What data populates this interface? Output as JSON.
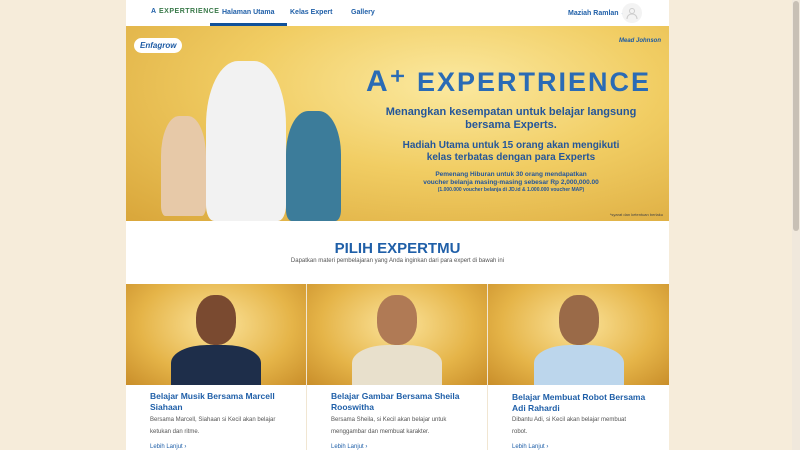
{
  "nav": {
    "logo": "EXPERTRIENCE",
    "items": [
      "Halaman Utama",
      "Kelas Expert",
      "Gallery"
    ],
    "user": "Maziah Ramlan"
  },
  "banner": {
    "brand": "Enfagrow",
    "maker": "Mead Johnson",
    "title": "EXPERTRIENCE",
    "line1": "Menangkan kesempatan untuk belajar langsung",
    "line2": "bersama Experts.",
    "line3": "Hadiah Utama untuk 15 orang  akan mengikuti",
    "line4": "kelas terbatas dengan para Experts",
    "line5": "Pemenang Hiburan untuk 30 orang mendapatkan",
    "line6": "voucher belanja masing-masing sebesar Rp 2,000,000.00",
    "line7": "(1.000.000 voucher belanja di JD.id & 1.000.000 voucher MAP)",
    "terms": "*syarat dan ketentuan berlaku"
  },
  "section": {
    "title": "PILIH EXPERTMU",
    "subtitle": "Dapatkan materi pembelajaran yang Anda inginkan dari para expert di bawah ini"
  },
  "cards": [
    {
      "title": "Belajar Musik Bersama Marcell Siahaan",
      "desc": "Bersama Marcell, Siahaan si Kecil akan belajar ketukan dan ritme.",
      "link": "Lebih Lanjut"
    },
    {
      "title": "Belajar Gambar Bersama Sheila Rooswitha",
      "desc": "Bersama Sheila, si Kecil akan belajar untuk menggambar dan membuat karakter.",
      "link": "Lebih Lanjut"
    },
    {
      "title": "Belajar Membuat Robot Bersama Adi Rahardi",
      "desc": "Dibantu Adi, si Kecil akan belajar membuat robot.",
      "link": "Lebih Lanjut"
    }
  ]
}
